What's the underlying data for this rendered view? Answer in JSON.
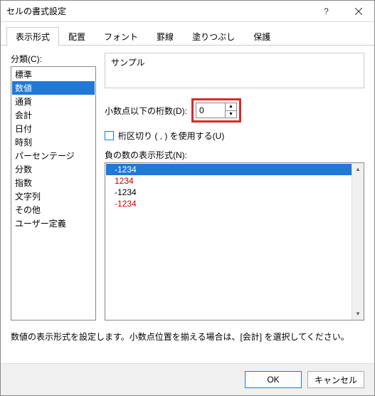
{
  "window": {
    "title": "セルの書式設定"
  },
  "tabs": [
    {
      "label": "表示形式",
      "active": true
    },
    {
      "label": "配置"
    },
    {
      "label": "フォント"
    },
    {
      "label": "罫線"
    },
    {
      "label": "塗りつぶし"
    },
    {
      "label": "保護"
    }
  ],
  "category": {
    "label": "分類(C):",
    "items": [
      {
        "label": "標準"
      },
      {
        "label": "数値",
        "selected": true
      },
      {
        "label": "通貨"
      },
      {
        "label": "会計"
      },
      {
        "label": "日付"
      },
      {
        "label": "時刻"
      },
      {
        "label": "パーセンテージ"
      },
      {
        "label": "分数"
      },
      {
        "label": "指数"
      },
      {
        "label": "文字列"
      },
      {
        "label": "その他"
      },
      {
        "label": "ユーザー定義"
      }
    ]
  },
  "sample": {
    "label": "サンプル",
    "value": ""
  },
  "decimal": {
    "label": "小数点以下の桁数(D):",
    "value": "0"
  },
  "separator": {
    "label": "桁区切り ( , ) を使用する(U)",
    "checked": false
  },
  "negative": {
    "label": "負の数の表示形式(N):",
    "items": [
      {
        "text": "-1234",
        "selected": true,
        "color": "white"
      },
      {
        "text": "1234",
        "color": "red"
      },
      {
        "text": "-1234",
        "color": "black"
      },
      {
        "text": "-1234",
        "color": "red"
      }
    ]
  },
  "description": "数値の表示形式を設定します。小数点位置を揃える場合は、[会計] を選択してください。",
  "buttons": {
    "ok": "OK",
    "cancel": "キャンセル"
  }
}
